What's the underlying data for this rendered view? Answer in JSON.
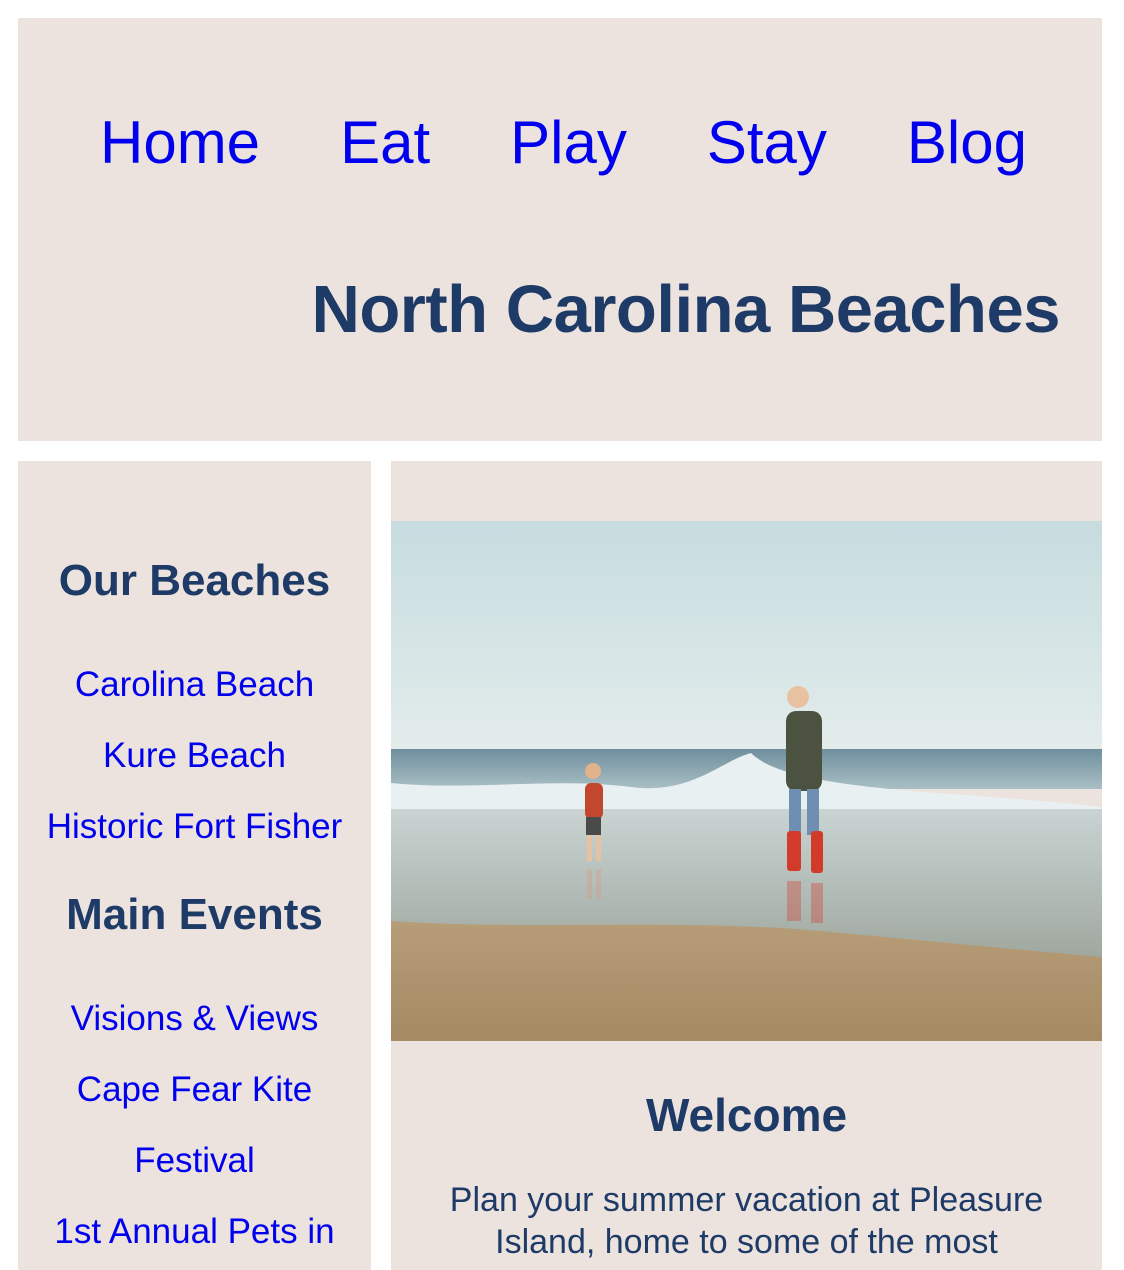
{
  "nav": {
    "items": [
      "Home",
      "Eat",
      "Play",
      "Stay",
      "Blog"
    ]
  },
  "header": {
    "title": "North Carolina Beaches"
  },
  "sidebar": {
    "beaches_heading": "Our Beaches",
    "beaches": [
      "Carolina Beach",
      "Kure Beach",
      "Historic Fort Fisher"
    ],
    "events_heading": "Main Events",
    "events": [
      "Visions & Views",
      "Cape Fear Kite",
      "Festival",
      "1st Annual Pets in"
    ]
  },
  "main": {
    "welcome_title": "Welcome",
    "welcome_text": "Plan your summer vacation at Pleasure Island, home to some of the most"
  },
  "colors": {
    "panel_bg": "#ece2de",
    "heading": "#1e3a66",
    "link": "#0000ee"
  }
}
